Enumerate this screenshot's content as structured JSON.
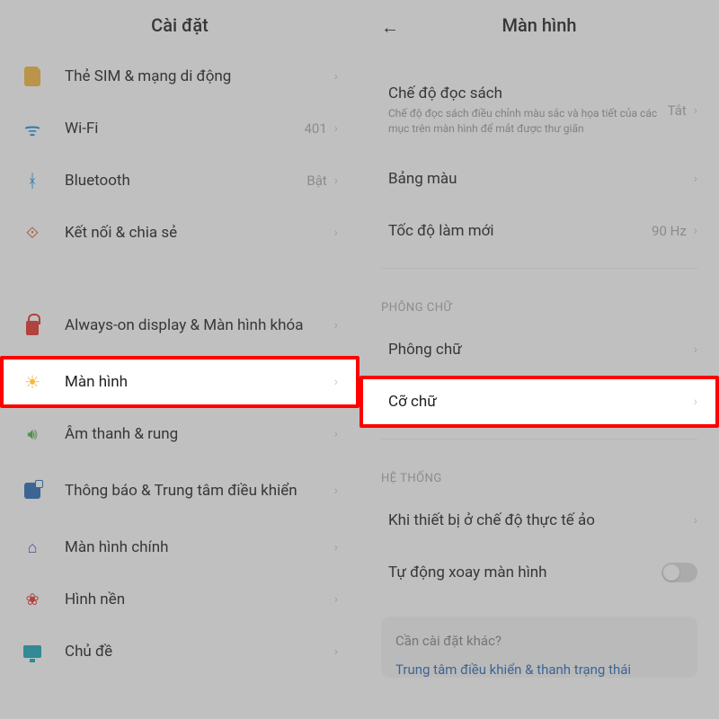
{
  "left": {
    "title": "Cài đặt",
    "items": {
      "sim": {
        "label": "Thẻ SIM & mạng di động"
      },
      "wifi": {
        "label": "Wi-Fi",
        "value": "401"
      },
      "bluetooth": {
        "label": "Bluetooth",
        "value": "Bật"
      },
      "share": {
        "label": "Kết nối & chia sẻ"
      },
      "aod": {
        "label": "Always-on display & Màn hình khóa"
      },
      "display": {
        "label": "Màn hình"
      },
      "sound": {
        "label": "Âm thanh & rung"
      },
      "notif": {
        "label": "Thông báo & Trung tâm điều khiển"
      },
      "home": {
        "label": "Màn hình chính"
      },
      "wallpaper": {
        "label": "Hình nền"
      },
      "theme": {
        "label": "Chủ đề"
      }
    }
  },
  "right": {
    "title": "Màn hình",
    "reading": {
      "title": "Chế độ đọc sách",
      "desc": "Chế độ đọc sách điều chỉnh màu sắc và họa tiết của các mục trên màn hình để mắt được thư giãn",
      "value": "Tắt"
    },
    "palette": {
      "label": "Bảng màu"
    },
    "refresh": {
      "label": "Tốc độ làm mới",
      "value": "90 Hz"
    },
    "section_font": "PHÔNG CHỮ",
    "font": {
      "label": "Phông chữ"
    },
    "fontsize": {
      "label": "Cỡ chữ"
    },
    "section_system": "HỆ THỐNG",
    "vr": {
      "label": "Khi thiết bị ở chế độ thực tế ảo"
    },
    "rotate": {
      "label": "Tự động xoay màn hình"
    },
    "more": {
      "q": "Cần cài đặt khác?",
      "link": "Trung tâm điều khiển & thanh trạng thái"
    }
  }
}
